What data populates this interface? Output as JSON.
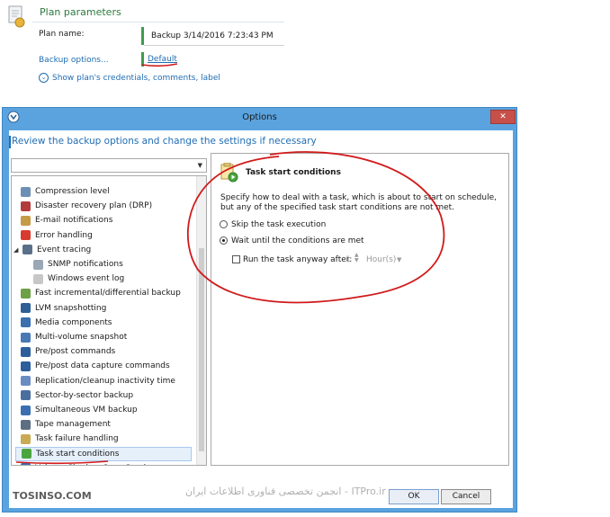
{
  "plan": {
    "title": "Plan parameters",
    "name_label": "Plan name:",
    "name_value": "Backup 3/14/2016 7:23:43 PM",
    "backup_options_label": "Backup options...",
    "backup_options_value": "Default",
    "show_credentials": "Show plan's credentials, comments, label"
  },
  "dialog": {
    "title": "Options",
    "banner": "Review the backup options and change the settings if necessary",
    "tree": [
      {
        "label": "Compression level",
        "icon": "compression-icon",
        "color": "#6b8fb5"
      },
      {
        "label": "Disaster recovery plan (DRP)",
        "icon": "drp-icon",
        "color": "#b23c3c"
      },
      {
        "label": "E-mail notifications",
        "icon": "email-icon",
        "color": "#c59b45"
      },
      {
        "label": "Error handling",
        "icon": "error-icon",
        "color": "#d73b2f"
      },
      {
        "label": "Event tracing",
        "icon": "event-icon",
        "color": "#5a6f8a"
      },
      {
        "label": "SNMP notifications",
        "icon": "snmp-icon",
        "color": "#9aa7b5"
      },
      {
        "label": "Windows event log",
        "icon": "winlog-icon",
        "color": "#c7c7c7"
      },
      {
        "label": "Fast incremental/differential backup",
        "icon": "fast-icon",
        "color": "#6ea046"
      },
      {
        "label": "LVM snapshotting",
        "icon": "lvm-icon",
        "color": "#2e5f96"
      },
      {
        "label": "Media components",
        "icon": "media-icon",
        "color": "#3b6fb0"
      },
      {
        "label": "Multi-volume snapshot",
        "icon": "multivol-icon",
        "color": "#4a78b5"
      },
      {
        "label": "Pre/post commands",
        "icon": "prepost-icon",
        "color": "#2b5e9b"
      },
      {
        "label": "Pre/post data capture commands",
        "icon": "prepost-data-icon",
        "color": "#2b5e9b"
      },
      {
        "label": "Replication/cleanup inactivity time",
        "icon": "replication-icon",
        "color": "#6a8cc2"
      },
      {
        "label": "Sector-by-sector backup",
        "icon": "sector-icon",
        "color": "#4a6f9f"
      },
      {
        "label": "Simultaneous VM backup",
        "icon": "vm-icon",
        "color": "#3b6fb0"
      },
      {
        "label": "Tape management",
        "icon": "tape-icon",
        "color": "#5c6e82"
      },
      {
        "label": "Task failure handling",
        "icon": "failure-icon",
        "color": "#c9ab55"
      },
      {
        "label": "Task start conditions",
        "icon": "start-conditions-icon",
        "color": "#4aa53f"
      },
      {
        "label": "Volume Shadow Copy Service",
        "icon": "vss-icon",
        "color": "#3b6fb0"
      }
    ],
    "detail": {
      "title": "Task start conditions",
      "description": "Specify how to deal with a task, which is about to start on schedule, but any of the specified task start conditions are not met.",
      "option_skip": "Skip the task execution",
      "option_wait": "Wait until the conditions are met",
      "run_anyway": "Run the task anyway after:",
      "run_value": "1",
      "run_unit": "Hour(s)"
    },
    "ok": "OK",
    "cancel": "Cancel"
  },
  "watermark": {
    "left": "TOSINSO.COM",
    "right": "انجمن تخصصی فناوری اطلاعات ایران - ITPro.ir"
  }
}
